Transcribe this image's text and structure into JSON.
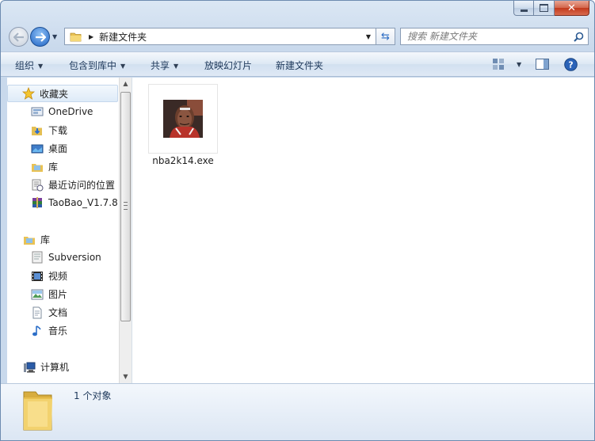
{
  "address": {
    "folder_name": "新建文件夹"
  },
  "search": {
    "placeholder": "搜索 新建文件夹"
  },
  "toolbar": {
    "organize": "组织",
    "include_library": "包含到库中",
    "share": "共享",
    "slideshow": "放映幻灯片",
    "new_folder": "新建文件夹"
  },
  "nav": {
    "favorites": "收藏夹",
    "favorites_items": [
      "OneDrive",
      "下载",
      "桌面",
      "库",
      "最近访问的位置",
      "TaoBao_V1.7.8."
    ],
    "libraries": "库",
    "libraries_items": [
      "Subversion",
      "视频",
      "图片",
      "文档",
      "音乐"
    ],
    "computer": "计算机"
  },
  "files": [
    {
      "name": "nba2k14.exe"
    }
  ],
  "details": {
    "count": "1 个对象"
  },
  "colors": {
    "toolbar_text": "#1e395b",
    "accent_blue": "#1f63c4",
    "close_red": "#c2391c"
  }
}
